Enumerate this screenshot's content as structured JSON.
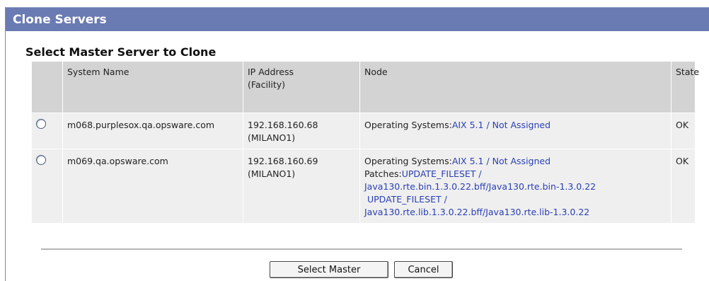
{
  "window": {
    "title": "Clone Servers"
  },
  "section": {
    "title": "Select Master Server to Clone"
  },
  "table": {
    "headers": {
      "select": "",
      "system_name": "System Name",
      "ip_address": "IP Address",
      "ip_facility": "(Facility)",
      "node": "Node",
      "state": "State"
    },
    "rows": [
      {
        "selected": false,
        "system_name": "m068.purplesox.qa.opsware.com",
        "ip": "192.168.160.68",
        "facility": "(MILANO1)",
        "os_label": "Operating Systems:",
        "os_link": "AIX 5.1 / Not Assigned",
        "state": "OK"
      },
      {
        "selected": false,
        "system_name": "m069.qa.opsware.com",
        "ip": "192.168.160.69",
        "facility": "(MILANO1)",
        "os_label": "Operating Systems:",
        "os_link": "AIX 5.1 / Not Assigned",
        "patches_label": "Patches:",
        "patch_lines": [
          "UPDATE_FILESET /",
          "Java130.rte.bin.1.3.0.22.bff/Java130.rte.bin-1.3.0.22",
          " UPDATE_FILESET /",
          "Java130.rte.lib.1.3.0.22.bff/Java130.rte.lib-1.3.0.22"
        ],
        "state": "OK"
      }
    ]
  },
  "buttons": {
    "select_master": "Select Master",
    "cancel": "Cancel"
  },
  "colors": {
    "titlebar": "#6a7ab2",
    "link": "#2a3fb5",
    "header_bg": "#d3d3d3",
    "row_bg": "#efefef"
  }
}
